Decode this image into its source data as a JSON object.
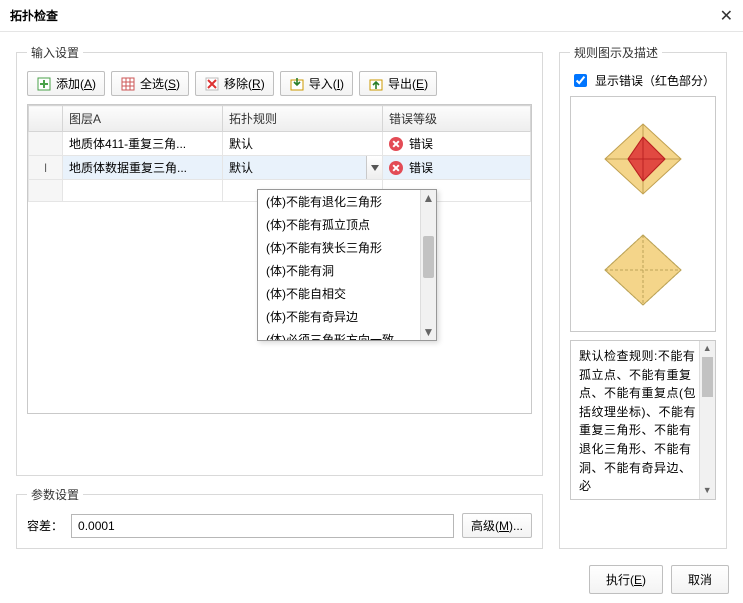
{
  "dialog": {
    "title": "拓扑检查",
    "close": "✕"
  },
  "input_group": {
    "legend": "输入设置",
    "toolbar": {
      "add": {
        "label": "添加(",
        "key": "A",
        "tail": ")"
      },
      "all": {
        "label": "全选(",
        "key": "S",
        "tail": ")"
      },
      "remove": {
        "label": "移除(",
        "key": "R",
        "tail": ")"
      },
      "import": {
        "label": "导入(",
        "key": "I",
        "tail": ")"
      },
      "export": {
        "label": "导出(",
        "key": "E",
        "tail": ")"
      }
    },
    "columns": {
      "layer": "图层A",
      "rule": "拓扑规则",
      "level": "错误等级"
    },
    "rows": [
      {
        "layer": "地质体411-重复三角...",
        "rule": "默认",
        "level": "错误",
        "selected": false
      },
      {
        "layer": "地质体数据重复三角...",
        "rule": "默认",
        "level": "错误",
        "selected": true
      }
    ],
    "dropdown_items": [
      "(体)不能有退化三角形",
      "(体)不能有孤立顶点",
      "(体)不能有狭长三角形",
      "(体)不能有洞",
      "(体)不能自相交",
      "(体)不能有奇异边",
      "(体)必须三角形方向一致"
    ]
  },
  "params_group": {
    "legend": "参数设置",
    "tolerance_label": "容差：",
    "tolerance_value": "0.0001",
    "advanced": {
      "label": "高级(",
      "key": "M",
      "tail": ")..."
    }
  },
  "right_panel": {
    "legend": "规则图示及描述",
    "show_errors_label": "显示错误（红色部分）",
    "show_errors_checked": true,
    "description": "默认检查规则:不能有孤立点、不能有重复点、不能有重复点(包括纹理坐标)、不能有重复三角形、不能有退化三角形、不能有洞、不能有奇异边、必"
  },
  "footer": {
    "execute": {
      "label": "执行(",
      "key": "E",
      "tail": ")"
    },
    "cancel": "取消"
  }
}
